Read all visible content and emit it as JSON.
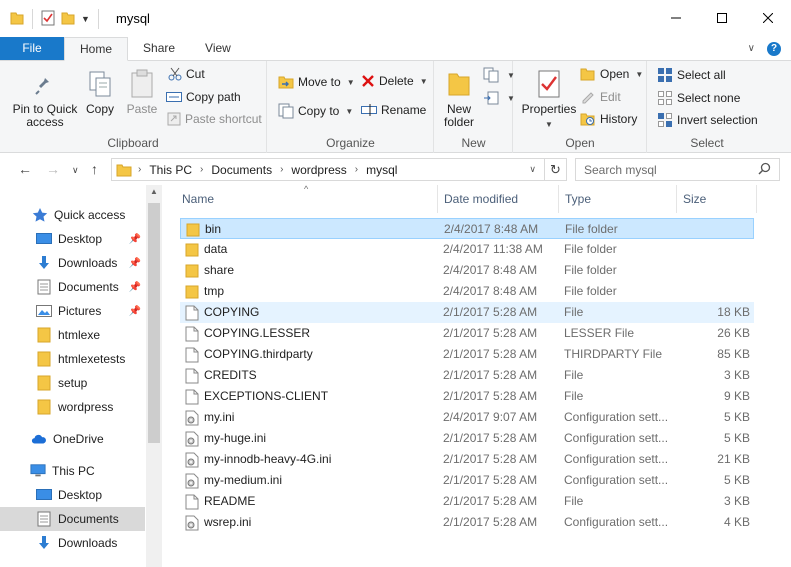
{
  "window": {
    "title": "mysql"
  },
  "tabs": {
    "file": "File",
    "home": "Home",
    "share": "Share",
    "view": "View"
  },
  "ribbon": {
    "clipboard": {
      "label": "Clipboard",
      "pin": "Pin to Quick access",
      "copy": "Copy",
      "paste": "Paste",
      "cut": "Cut",
      "copy_path": "Copy path",
      "paste_shortcut": "Paste shortcut"
    },
    "organize": {
      "label": "Organize",
      "move_to": "Move to",
      "copy_to": "Copy to",
      "delete": "Delete",
      "rename": "Rename"
    },
    "new": {
      "label": "New",
      "new_folder": "New folder"
    },
    "open": {
      "label": "Open",
      "properties": "Properties",
      "open": "Open",
      "edit": "Edit",
      "history": "History"
    },
    "select": {
      "label": "Select",
      "select_all": "Select all",
      "select_none": "Select none",
      "invert_selection": "Invert selection"
    }
  },
  "address": {
    "crumbs": [
      "This PC",
      "Documents",
      "wordpress",
      "mysql"
    ],
    "search_placeholder": "Search mysql"
  },
  "sidebar": {
    "quick_access": "Quick access",
    "items": [
      {
        "label": "Desktop",
        "pinned": true
      },
      {
        "label": "Downloads",
        "pinned": true
      },
      {
        "label": "Documents",
        "pinned": true
      },
      {
        "label": "Pictures",
        "pinned": true
      },
      {
        "label": "htmlexe",
        "pinned": false
      },
      {
        "label": "htmlexetests",
        "pinned": false
      },
      {
        "label": "setup",
        "pinned": false
      },
      {
        "label": "wordpress",
        "pinned": false
      }
    ],
    "onedrive": "OneDrive",
    "this_pc": "This PC",
    "pc_items": [
      "Desktop",
      "Documents",
      "Downloads"
    ]
  },
  "columns": {
    "name": "Name",
    "date": "Date modified",
    "type": "Type",
    "size": "Size"
  },
  "files": [
    {
      "name": "bin",
      "date": "2/4/2017 8:48 AM",
      "type": "File folder",
      "size": "",
      "icon": "folder-icon"
    },
    {
      "name": "data",
      "date": "2/4/2017 11:38 AM",
      "type": "File folder",
      "size": "",
      "icon": "folder-icon"
    },
    {
      "name": "share",
      "date": "2/4/2017 8:48 AM",
      "type": "File folder",
      "size": "",
      "icon": "folder-icon"
    },
    {
      "name": "tmp",
      "date": "2/4/2017 8:48 AM",
      "type": "File folder",
      "size": "",
      "icon": "folder-icon"
    },
    {
      "name": "COPYING",
      "date": "2/1/2017 5:28 AM",
      "type": "File",
      "size": "18 KB",
      "icon": "file-icon"
    },
    {
      "name": "COPYING.LESSER",
      "date": "2/1/2017 5:28 AM",
      "type": "LESSER File",
      "size": "26 KB",
      "icon": "file-icon"
    },
    {
      "name": "COPYING.thirdparty",
      "date": "2/1/2017 5:28 AM",
      "type": "THIRDPARTY File",
      "size": "85 KB",
      "icon": "file-icon"
    },
    {
      "name": "CREDITS",
      "date": "2/1/2017 5:28 AM",
      "type": "File",
      "size": "3 KB",
      "icon": "file-icon"
    },
    {
      "name": "EXCEPTIONS-CLIENT",
      "date": "2/1/2017 5:28 AM",
      "type": "File",
      "size": "9 KB",
      "icon": "file-icon"
    },
    {
      "name": "my.ini",
      "date": "2/4/2017 9:07 AM",
      "type": "Configuration sett...",
      "size": "5 KB",
      "icon": "config-file-icon"
    },
    {
      "name": "my-huge.ini",
      "date": "2/1/2017 5:28 AM",
      "type": "Configuration sett...",
      "size": "5 KB",
      "icon": "config-file-icon"
    },
    {
      "name": "my-innodb-heavy-4G.ini",
      "date": "2/1/2017 5:28 AM",
      "type": "Configuration sett...",
      "size": "21 KB",
      "icon": "config-file-icon"
    },
    {
      "name": "my-medium.ini",
      "date": "2/1/2017 5:28 AM",
      "type": "Configuration sett...",
      "size": "5 KB",
      "icon": "config-file-icon"
    },
    {
      "name": "README",
      "date": "2/1/2017 5:28 AM",
      "type": "File",
      "size": "3 KB",
      "icon": "file-icon"
    },
    {
      "name": "wsrep.ini",
      "date": "2/1/2017 5:28 AM",
      "type": "Configuration sett...",
      "size": "4 KB",
      "icon": "config-file-icon"
    }
  ],
  "selected_file": "bin",
  "hover_file": "COPYING",
  "colors": {
    "file_tab": "#1979ca",
    "selection": "#cce8ff",
    "folder": "#f4c645"
  }
}
